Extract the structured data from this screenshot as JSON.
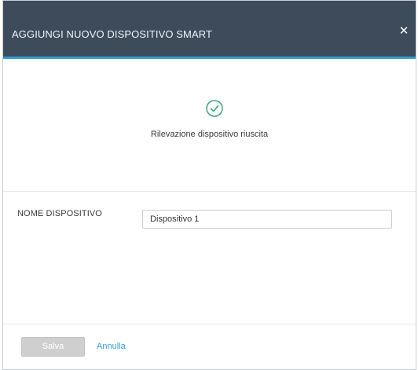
{
  "dialog": {
    "title": "AGGIUNGI NUOVO DISPOSITIVO SMART",
    "close_icon": "close-icon"
  },
  "status": {
    "icon": "check-circle-icon",
    "message": "Rilevazione dispositivo riuscita",
    "color": "#3aa57a"
  },
  "form": {
    "name_label": "NOME DISPOSITIVO",
    "name_value": "Dispositivo 1"
  },
  "footer": {
    "save_label": "Salva",
    "cancel_label": "Annulla"
  },
  "colors": {
    "header_bg": "#3d4b5b",
    "accent": "#2f9fd0",
    "save_disabled": "#cfcfcf"
  }
}
